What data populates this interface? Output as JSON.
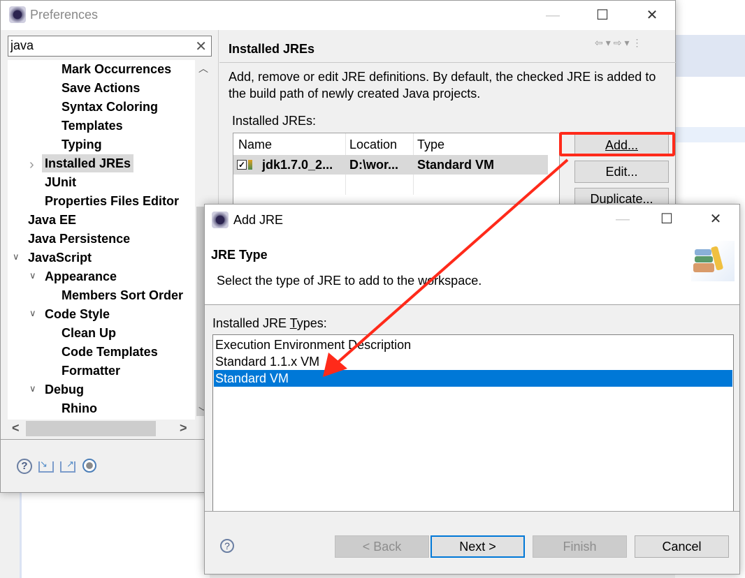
{
  "preferences": {
    "title": "Preferences",
    "search": {
      "value": "java"
    },
    "tree": [
      {
        "label": "Mark Occurrences",
        "level": 3
      },
      {
        "label": "Save Actions",
        "level": 3
      },
      {
        "label": "Syntax Coloring",
        "level": 3
      },
      {
        "label": "Templates",
        "level": 3
      },
      {
        "label": "Typing",
        "level": 3
      },
      {
        "label": "Installed JREs",
        "level": 2,
        "selected": true,
        "expander": "collapsed"
      },
      {
        "label": "JUnit",
        "level": 2
      },
      {
        "label": "Properties Files Editor",
        "level": 2
      },
      {
        "label": "Java EE",
        "level": 1
      },
      {
        "label": "Java Persistence",
        "level": 1
      },
      {
        "label": "JavaScript",
        "level": 1,
        "expander": "expanded"
      },
      {
        "label": "Appearance",
        "level": 2,
        "expander": "expanded"
      },
      {
        "label": "Members Sort Order",
        "level": 3
      },
      {
        "label": "Code Style",
        "level": 2,
        "expander": "expanded"
      },
      {
        "label": "Clean Up",
        "level": 3
      },
      {
        "label": "Code Templates",
        "level": 3
      },
      {
        "label": "Formatter",
        "level": 3
      },
      {
        "label": "Debug",
        "level": 2,
        "expander": "expanded"
      },
      {
        "label": "Rhino",
        "level": 3
      }
    ],
    "page": {
      "title": "Installed JREs",
      "description": "Add, remove or edit JRE definitions. By default, the checked JRE is added to the build path of newly created Java projects.",
      "table_label": "Installed JREs:",
      "columns": [
        "Name",
        "Location",
        "Type"
      ],
      "rows": [
        {
          "checked": true,
          "name": "jdk1.7.0_2...",
          "location": "D:\\wor...",
          "type": "Standard VM"
        }
      ],
      "buttons": {
        "add": "Add...",
        "edit": "Edit...",
        "duplicate": "Duplicate..."
      }
    }
  },
  "add_jre": {
    "title": "Add JRE",
    "heading": "JRE Type",
    "subtitle": "Select the type of JRE to add to the workspace.",
    "list_label": "Installed JRE Types:",
    "types": [
      "Execution Environment Description",
      "Standard 1.1.x VM",
      "Standard VM"
    ],
    "selected": "Standard VM",
    "buttons": {
      "back": "< Back",
      "next": "Next >",
      "finish": "Finish",
      "cancel": "Cancel"
    }
  },
  "colors": {
    "selection": "#0078d7",
    "annotation": "#ff2a1a"
  }
}
